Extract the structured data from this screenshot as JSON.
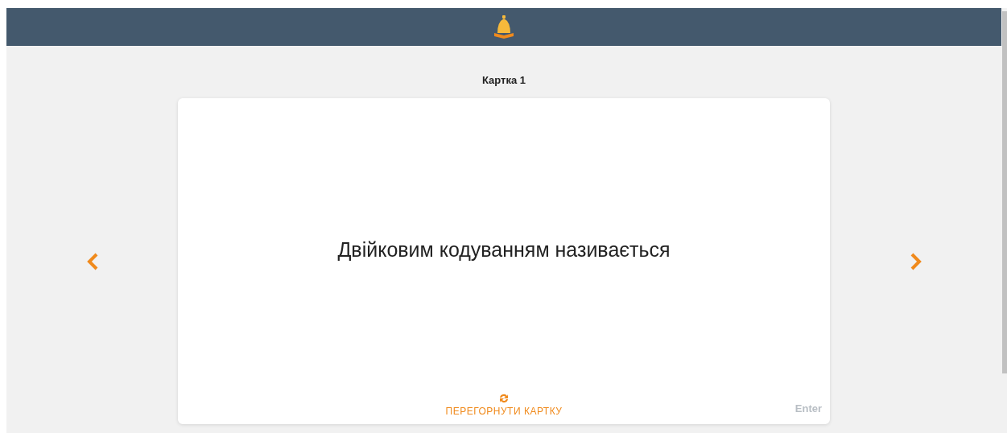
{
  "card_title": "Картка 1",
  "card": {
    "question": "Двійковим кодуванням називається",
    "flip_label": "ПЕРЕГОРНУТИ КАРТКУ",
    "shortcut": "Enter"
  }
}
